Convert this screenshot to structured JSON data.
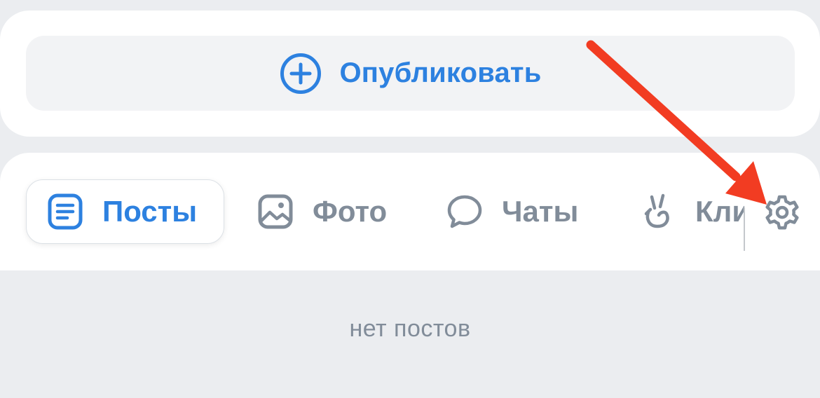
{
  "publish": {
    "label": "Опубликовать",
    "icon": "plus-circle-icon"
  },
  "tabs": [
    {
      "label": "Посты",
      "icon": "document-lines-icon",
      "active": true
    },
    {
      "label": "Фото",
      "icon": "image-icon",
      "active": false
    },
    {
      "label": "Чаты",
      "icon": "chat-bubble-icon",
      "active": false
    },
    {
      "label": "Кли",
      "icon": "clips-icon",
      "active": false
    }
  ],
  "settings": {
    "icon": "gear-icon"
  },
  "empty_state": {
    "text": "нет постов"
  },
  "annotation": {
    "icon": "red-arrow-icon",
    "color": "#f23c22"
  },
  "colors": {
    "accent": "#2d81e0",
    "inactive": "#818c99",
    "background": "#ebedf0",
    "card": "#ffffff",
    "button_bg": "#f2f3f5"
  }
}
